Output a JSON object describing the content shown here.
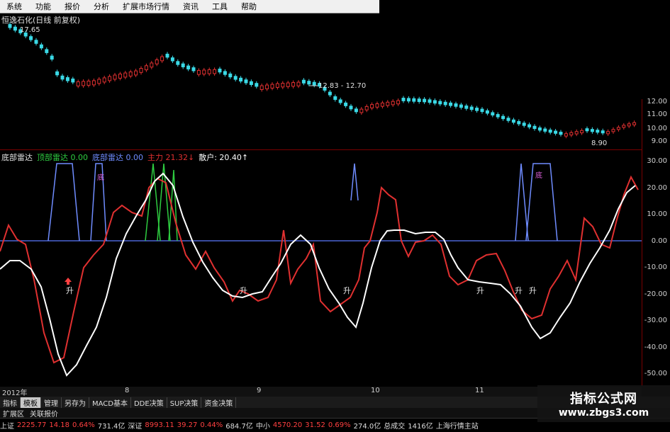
{
  "menu": [
    "系统",
    "功能",
    "报价",
    "分析",
    "扩展市场行情",
    "资讯",
    "工具",
    "帮助"
  ],
  "chart_title": "恒逸石化(日线 前复权)",
  "price_annotations": {
    "high_label": "17.65",
    "range_label": "12.83 - 12.70",
    "low_label": "8.90"
  },
  "price_axis": [
    "12.00",
    "11.00",
    "10.00",
    "9.00"
  ],
  "indicator_legend": [
    {
      "text": "底部雷达",
      "color": "#e0e0e0"
    },
    {
      "text": "顶部雷达  0.00",
      "color": "#2ecc40"
    },
    {
      "text": "底部雷达  0.00",
      "color": "#6f8cff"
    },
    {
      "text": "主力  21.32↓",
      "color": "#e03030"
    },
    {
      "text": "散户:  20.40↑",
      "color": "#ffffff"
    }
  ],
  "indicator_axis": [
    "30.00",
    "20.00",
    "10.00",
    "0.00",
    "-10.00",
    "-20.00",
    "-30.00",
    "-40.00",
    "-50.00"
  ],
  "signal_label": "升",
  "bottom_marker": "底",
  "time_axis": [
    "2012年",
    "8",
    "9",
    "10",
    "11"
  ],
  "tabs": [
    {
      "label": "指标",
      "active": false
    },
    {
      "label": "模板",
      "active": true
    },
    {
      "label": "管理",
      "active": false
    },
    {
      "label": "另存为",
      "active": false
    },
    {
      "label": "MACD基本",
      "active": false
    },
    {
      "label": "DDE决策",
      "active": false
    },
    {
      "label": "SUP决策",
      "active": false
    },
    {
      "label": "资金决策",
      "active": false
    }
  ],
  "tabs2": [
    "扩展区",
    "关联报价"
  ],
  "status": [
    {
      "text": "上证",
      "color": "#ddd"
    },
    {
      "text": "2225.77",
      "color": "#ff4040"
    },
    {
      "text": "14.18",
      "color": "#ff4040"
    },
    {
      "text": "0.64%",
      "color": "#ff4040"
    },
    {
      "text": "731.4亿",
      "color": "#ddd"
    },
    {
      "text": "深证",
      "color": "#ddd"
    },
    {
      "text": "8993.11",
      "color": "#ff4040"
    },
    {
      "text": "39.27",
      "color": "#ff4040"
    },
    {
      "text": "0.44%",
      "color": "#ff4040"
    },
    {
      "text": "684.7亿",
      "color": "#ddd"
    },
    {
      "text": "中小",
      "color": "#ddd"
    },
    {
      "text": "4570.20",
      "color": "#ff4040"
    },
    {
      "text": "31.52",
      "color": "#ff4040"
    },
    {
      "text": "0.69%",
      "color": "#ff4040"
    },
    {
      "text": "274.0亿",
      "color": "#ddd"
    },
    {
      "text": "总成交",
      "color": "#ddd"
    },
    {
      "text": "1416亿",
      "color": "#ddd"
    },
    {
      "text": "上海行情主站",
      "color": "#ddd"
    }
  ],
  "watermark": {
    "line1": "指标公式网",
    "line2": "www.zbgs3.com"
  },
  "colors": {
    "up": "#e03030",
    "down": "#3ad9e6",
    "grid": "#7a0000",
    "signal_blue": "#6f8cff",
    "signal_green": "#2ecc40",
    "retail_line": "#ffffff"
  }
}
